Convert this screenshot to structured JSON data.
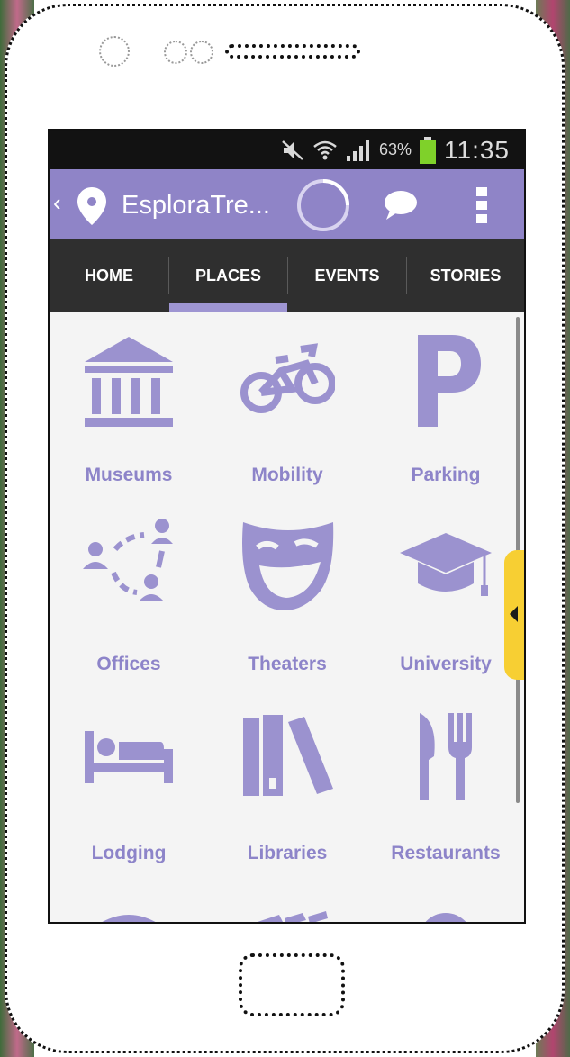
{
  "status_bar": {
    "battery_percent": "63%",
    "time": "11:35",
    "icons": [
      "mute-icon",
      "wifi-icon",
      "signal-icon",
      "battery-icon"
    ]
  },
  "action_bar": {
    "title": "EsploraTre...",
    "back_icon": "chevron-left-icon",
    "app_icon": "location-pin-icon",
    "actions": [
      "loading-spinner",
      "chat-icon",
      "overflow-menu-icon"
    ]
  },
  "tabs": [
    {
      "label": "HOME",
      "selected": false
    },
    {
      "label": "PLACES",
      "selected": true
    },
    {
      "label": "EVENTS",
      "selected": false
    },
    {
      "label": "STORIES",
      "selected": false
    }
  ],
  "categories": [
    {
      "label": "Museums",
      "icon": "museum-icon"
    },
    {
      "label": "Mobility",
      "icon": "bicycle-icon"
    },
    {
      "label": "Parking",
      "icon": "parking-icon"
    },
    {
      "label": "Offices",
      "icon": "offices-icon"
    },
    {
      "label": "Theaters",
      "icon": "theater-mask-icon"
    },
    {
      "label": "University",
      "icon": "graduation-cap-icon"
    },
    {
      "label": "Lodging",
      "icon": "bed-icon"
    },
    {
      "label": "Libraries",
      "icon": "books-icon"
    },
    {
      "label": "Restaurants",
      "icon": "fork-knife-icon"
    }
  ],
  "colors": {
    "accent": "#8f84c7",
    "icon": "#9b92cf",
    "label": "#8d84c9",
    "tab_bar": "#2f2f2f",
    "status_bar": "#121212",
    "drawer_handle": "#f7cf33"
  }
}
